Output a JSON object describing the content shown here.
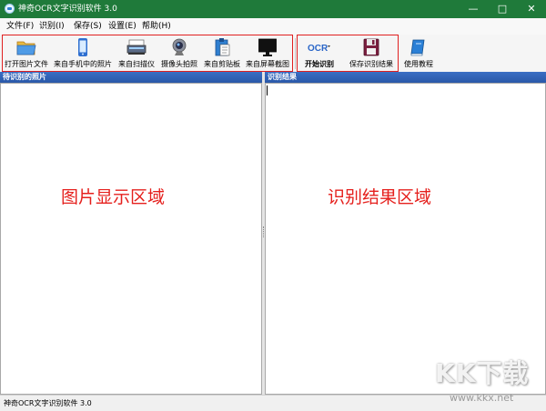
{
  "window": {
    "title": "神奇OCR文字识别软件 3.0",
    "minimize": "—",
    "maximize": "□",
    "close": "✕"
  },
  "menu": [
    "文件(F)",
    "识别(I)",
    "保存(S)",
    "设置(E)",
    "帮助(H)"
  ],
  "toolbar": {
    "group1": [
      {
        "label": "打开图片文件",
        "icon": "folder-icon"
      },
      {
        "label": "来自手机中的照片",
        "icon": "phone-icon"
      },
      {
        "label": "来自扫描仪",
        "icon": "scanner-icon"
      },
      {
        "label": "摄像头拍照",
        "icon": "webcam-icon"
      },
      {
        "label": "来自剪贴板",
        "icon": "clipboard-icon"
      },
      {
        "label": "来自屏幕截图",
        "icon": "monitor-icon"
      }
    ],
    "group2": [
      {
        "label": "开始识别",
        "icon": "ocr-icon",
        "icon_text": "OCR"
      },
      {
        "label": "保存识别结果",
        "icon": "floppy-disk-icon"
      }
    ],
    "help": {
      "label": "使用教程",
      "icon": "book-icon"
    }
  },
  "left_pane": {
    "header": "待识别的照片",
    "placeholder": "图片显示区域"
  },
  "right_pane": {
    "header": "识别结果",
    "placeholder": "识别结果区域"
  },
  "statusbar": {
    "text": "神奇OCR文字识别软件 3.0"
  },
  "watermark": {
    "brand": "KK下载",
    "url": "www.kkx.net"
  },
  "colors": {
    "titlebar": "#1f7a3a",
    "pane_header": "#2a58a8",
    "annotation_red": "#e02020"
  }
}
